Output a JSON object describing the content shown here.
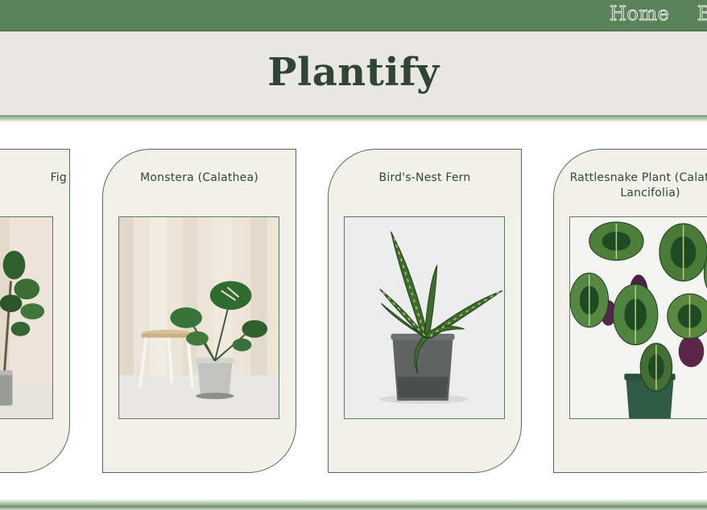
{
  "nav": {
    "links": [
      "Home",
      "B"
    ]
  },
  "header": {
    "title": "Plantify"
  },
  "plants": [
    {
      "name": "Fig"
    },
    {
      "name": "Monstera (Calathea)"
    },
    {
      "name": "Bird's-Nest Fern"
    },
    {
      "name": "Rattlesnake Plant (Calathea Lancifolia)"
    }
  ],
  "colors": {
    "nav_background": "#5a835b",
    "header_background": "#e8e7e3",
    "title": "#304534",
    "card_background": "#f1f0eb",
    "card_border": "#546b55"
  }
}
